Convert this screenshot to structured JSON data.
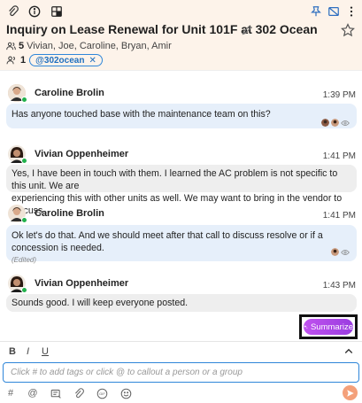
{
  "header": {
    "title": "Inquiry on Lease Renewal for Unit 101F at 302 Ocean",
    "participant_count": "5",
    "participants": "Vivian, Joe, Caroline, Bryan, Amir",
    "tag_count": "1",
    "tags": [
      "@302ocean"
    ]
  },
  "messages": [
    {
      "sender": "Caroline Brolin",
      "time": "1:39 PM",
      "lines": [
        "Has anyone touched base with the maintenance team on this?"
      ],
      "edited": ""
    },
    {
      "sender": "Vivian Oppenheimer",
      "time": "1:41 PM",
      "lines": [
        "Yes, I have been in touch with them.  I learned the AC problem is not specific to this unit.  We are",
        "experiencing this with other units as well.  We may want to bring in the vendor to discuss"
      ],
      "edited": ""
    },
    {
      "sender": "Caroline Brolin",
      "time": "1:41 PM",
      "lines": [
        "Ok let's do that. And we should meet after that call to discuss resolve or if a concession is needed."
      ],
      "edited": "(Edited)"
    },
    {
      "sender": "Vivian Oppenheimer",
      "time": "1:43 PM",
      "lines": [
        "Sounds good.  I will keep everyone posted."
      ],
      "edited": ""
    }
  ],
  "summarize_label": "Summarize",
  "composer": {
    "placeholder": "Click # to add tags or click @ to callout a person or a group",
    "format": {
      "bold": "B",
      "italic": "I",
      "underline": "U"
    }
  },
  "icons": {
    "toolbar_left": [
      "paperclip-icon",
      "info-icon",
      "grid-icon"
    ],
    "toolbar_right": [
      "pin-icon",
      "hide-icon",
      "more-vertical-icon"
    ],
    "bottom": [
      "hashtag-icon",
      "at-icon",
      "card-icon",
      "paperclip-icon",
      "gif-icon",
      "emoji-icon"
    ]
  },
  "colors": {
    "accent": "#2f86d9",
    "summarize": "#b04ae8",
    "send": "#f4a07a",
    "online": "#22b14c"
  }
}
